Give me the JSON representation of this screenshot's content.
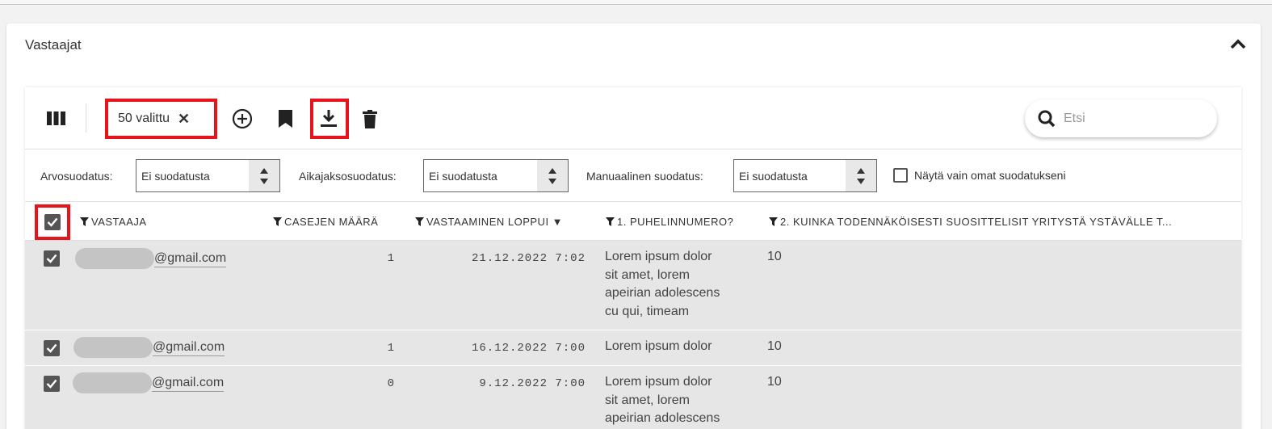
{
  "panel": {
    "title": "Vastaajat"
  },
  "toolbar": {
    "selected_label": "50 valittu",
    "clear_icon": "✕",
    "search_placeholder": "Etsi"
  },
  "filters": {
    "value_label": "Arvosuodatus:",
    "value_selected": "Ei suodatusta",
    "period_label": "Aikajaksosuodatus:",
    "period_selected": "Ei suodatusta",
    "manual_label": "Manuaalinen suodatus:",
    "manual_selected": "Ei suodatusta",
    "own_only_label": "Näytä vain omat suodatukseni"
  },
  "table": {
    "columns": [
      "VASTAAJA",
      "CASEJEN MÄÄRÄ",
      "VASTAAMINEN LOPPUI",
      "1. PUHELINNUMERO?",
      "2. KUINKA TODENNÄKÖISESTI SUOSITTELISIT YRITYSTÄ YSTÄVÄLLE T..."
    ],
    "sort_icon": "▼",
    "rows": [
      {
        "email": "@gmail.com",
        "cases": "1",
        "ended": "21.12.2022 7:02",
        "phone_lines": [
          "Lorem ipsum dolor",
          "sit amet, lorem",
          "apeirian adolescens",
          "cu qui, timeam"
        ],
        "nps": "10"
      },
      {
        "email": "@gmail.com",
        "cases": "1",
        "ended": "16.12.2022 7:00",
        "phone_lines": [
          "Lorem ipsum dolor"
        ],
        "nps": "10"
      },
      {
        "email": "@gmail.com",
        "cases": "0",
        "ended": "9.12.2022 7:00",
        "phone_lines": [
          "Lorem ipsum dolor",
          "sit amet, lorem",
          "apeirian adolescens"
        ],
        "nps": "10"
      }
    ]
  },
  "colors": {
    "highlight": "#e8141c",
    "row_bg": "#e6e6e6",
    "checkbox": "#555555"
  }
}
